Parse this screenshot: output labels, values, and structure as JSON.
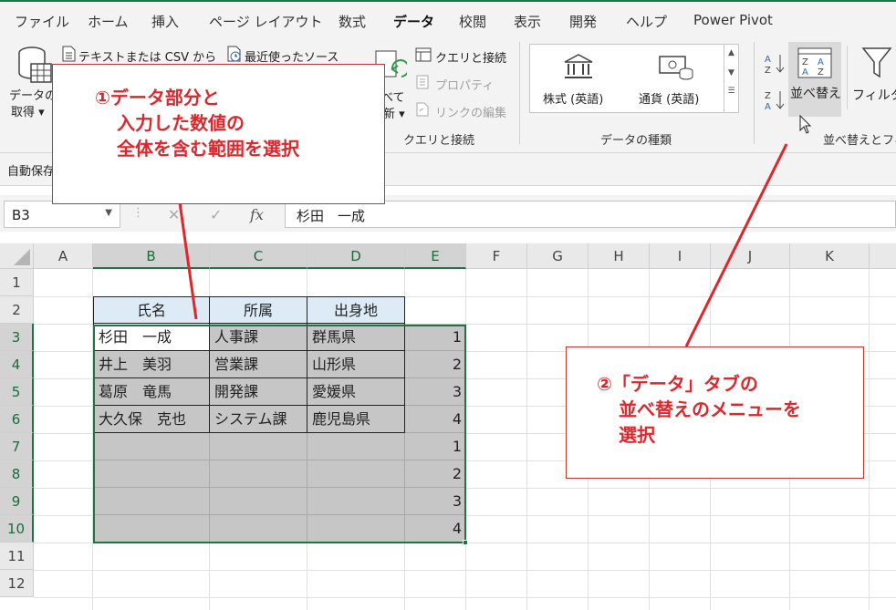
{
  "tabs": [
    "ファイル",
    "ホーム",
    "挿入",
    "ページ レイアウト",
    "数式",
    "データ",
    "校閲",
    "表示",
    "開発",
    "ヘルプ",
    "Power Pivot"
  ],
  "active_tab": "データ",
  "accent_color": "#217346",
  "ribbon": {
    "get_data_line1": "データの",
    "get_data_line2": "取得 ▾",
    "from_text_csv": "テキストまたは CSV から",
    "recent_sources": "最近使ったソース",
    "refresh_all_line1": "べて",
    "refresh_all_line2": "新 ▾",
    "queries_connections": "クエリと接続",
    "properties": "プロパティ",
    "edit_links": "リンクの編集",
    "group_queries": "クエリと接続",
    "stocks": "株式 (英語)",
    "currencies": "通貨 (英語)",
    "group_data_types": "データの種類",
    "sort": "並べ替え",
    "filter": "フィルター",
    "group_sort_filter": "並べ替えとフィ",
    "autosave": "自動保存"
  },
  "formula_bar": {
    "name_box": "B3",
    "fx": "fx",
    "content": "杉田　一成"
  },
  "columns": [
    "A",
    "B",
    "C",
    "D",
    "E",
    "F",
    "G",
    "H",
    "I",
    "J",
    "K"
  ],
  "rows": [
    "1",
    "2",
    "3",
    "4",
    "5",
    "6",
    "7",
    "8",
    "9",
    "10",
    "11",
    "12"
  ],
  "table": {
    "headers": [
      "氏名",
      "所属",
      "出身地"
    ],
    "rows": [
      [
        "杉田　一成",
        "人事課",
        "群馬県",
        "1"
      ],
      [
        "井上　美羽",
        "営業課",
        "山形県",
        "2"
      ],
      [
        "葛原　竜馬",
        "開発課",
        "愛媛県",
        "3"
      ],
      [
        "大久保　克也",
        "システム課",
        "鹿児島県",
        "4"
      ],
      [
        "",
        "",
        "",
        "1"
      ],
      [
        "",
        "",
        "",
        "2"
      ],
      [
        "",
        "",
        "",
        "3"
      ],
      [
        "",
        "",
        "",
        "4"
      ]
    ]
  },
  "callouts": {
    "step1": [
      "①データ部分と",
      "入力した数値の",
      "全体を含む範囲を選択"
    ],
    "step2": [
      "②「データ」タブの",
      "並べ替えのメニューを",
      "選択"
    ],
    "color": "#e0262b"
  }
}
